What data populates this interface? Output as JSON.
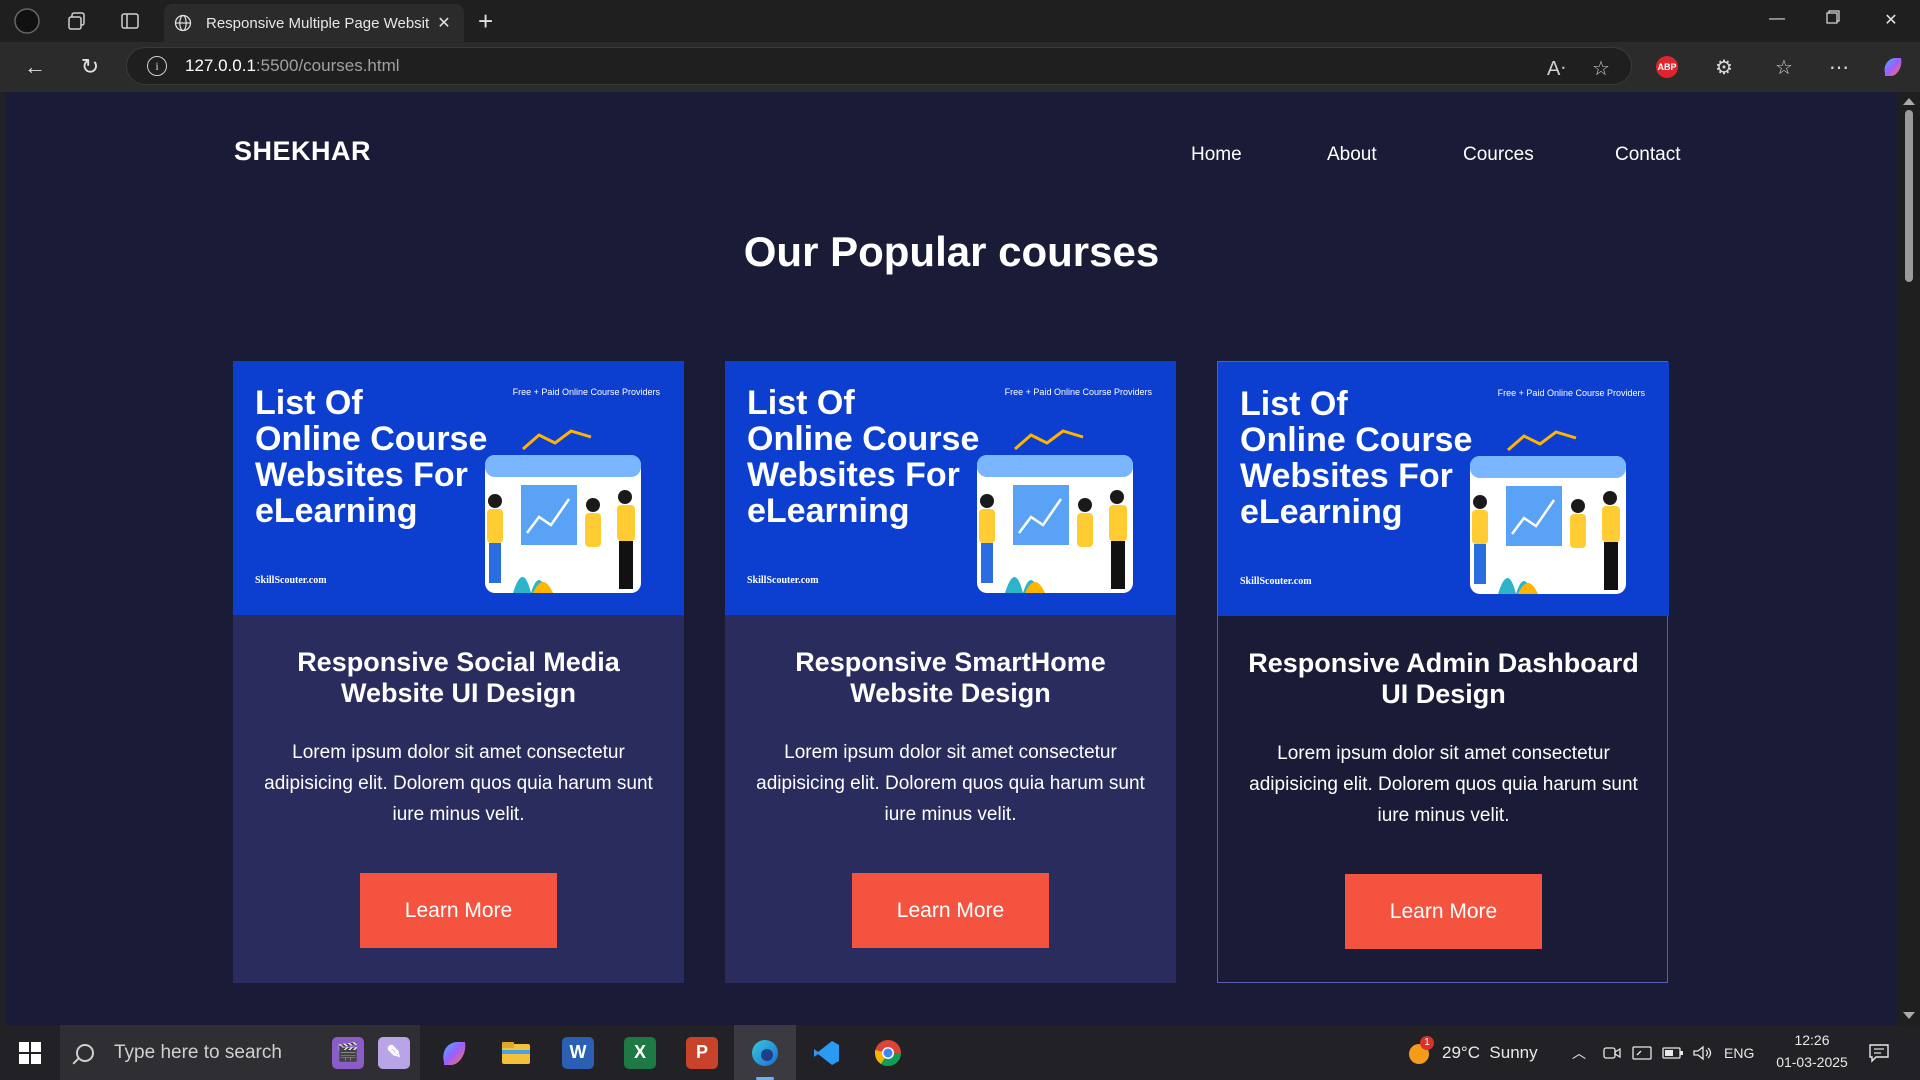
{
  "browser": {
    "tab_title": "Responsive Multiple Page Websit",
    "url_host": "127.0.0.1",
    "url_path": ":5500/courses.html"
  },
  "page": {
    "logo": "SHEKHAR",
    "nav": [
      "Home",
      "About",
      "Cources",
      "Contact"
    ],
    "heading": "Our Popular courses",
    "courses": [
      {
        "banner_title_1": "List Of",
        "banner_title_2": "Online Course",
        "banner_title_3": "Websites For",
        "banner_title_4": "eLearning",
        "banner_tag": "Free + Paid Online Course Providers",
        "banner_site": "SkillScouter.com",
        "title": "Responsive Social Media Website UI Design",
        "description": "Lorem ipsum dolor sit amet consectetur adipisicing elit. Dolorem quos quia harum sunt iure minus velit.",
        "button": "Learn More"
      },
      {
        "banner_title_1": "List Of",
        "banner_title_2": "Online Course",
        "banner_title_3": "Websites For",
        "banner_title_4": "eLearning",
        "banner_tag": "Free + Paid Online Course Providers",
        "banner_site": "SkillScouter.com",
        "title": "Responsive SmartHome Website Design",
        "description": "Lorem ipsum dolor sit amet consectetur adipisicing elit. Dolorem quos quia harum sunt iure minus velit.",
        "button": "Learn More"
      },
      {
        "banner_title_1": "List Of",
        "banner_title_2": "Online Course",
        "banner_title_3": "Websites For",
        "banner_title_4": "eLearning",
        "banner_tag": "Free + Paid Online Course Providers",
        "banner_site": "SkillScouter.com",
        "title": "Responsive Admin Dashboard UI Design",
        "description": "Lorem ipsum dolor sit amet consectetur adipisicing elit. Dolorem quos quia harum sunt iure minus velit.",
        "button": "Learn More"
      }
    ]
  },
  "taskbar": {
    "search_placeholder": "Type here to search",
    "weather": "29°C  Sunny",
    "weather_badge": "1",
    "language": "ENG",
    "time": "12:26",
    "date": "01-03-2025"
  },
  "colors": {
    "page_bg": "#1a1c37",
    "card_bg": "#2a2c5e",
    "banner_bg": "#0c3fd0",
    "button_bg": "#f4533f"
  }
}
